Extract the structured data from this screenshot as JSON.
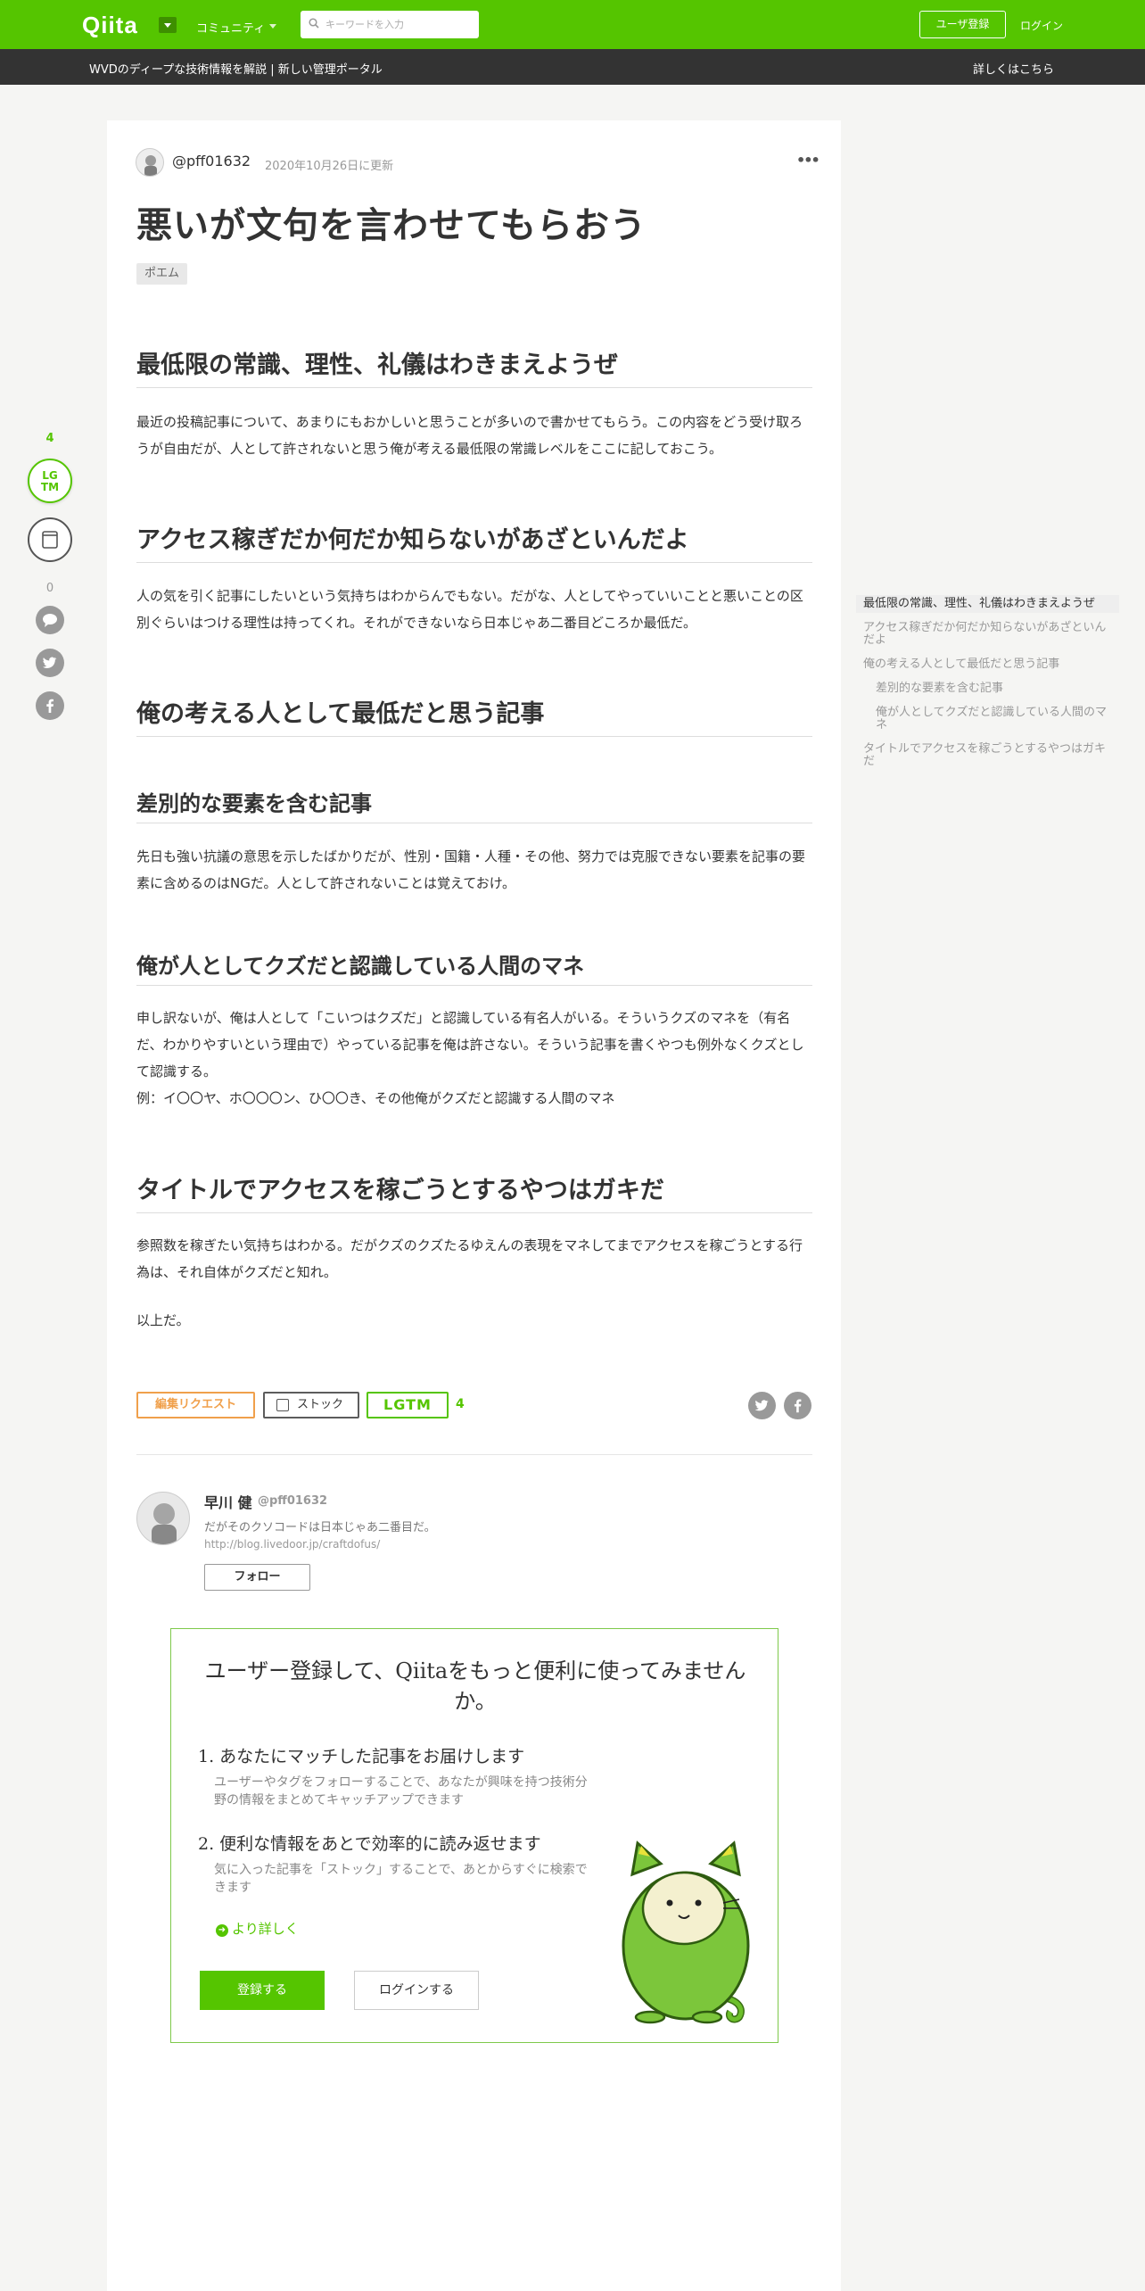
{
  "header": {
    "logo": "Qiita",
    "community": "コミュニティ",
    "search_placeholder": "キーワードを入力",
    "signup": "ユーザ登録",
    "login": "ログイン",
    "accent": "#55c500"
  },
  "banner": {
    "text": "WVDのディープな技術情報を解説 | 新しい管理ポータル",
    "link": "詳しくはこちら"
  },
  "article": {
    "author": "@pff01632",
    "updated": "2020年10月26日に更新",
    "menu": "•••",
    "title": "悪いが文句を言わせてもらおう",
    "tag": "ポエム",
    "sections": [
      {
        "heading": "最低限の常識、理性、礼儀はわきまえようぜ",
        "body": "最近の投稿記事について、あまりにもおかしいと思うことが多いので書かせてもらう。この内容をどう受け取ろうが自由だが、人として許されないと思う俺が考える最低限の常識レベルをここに記しておこう。"
      },
      {
        "heading": "アクセス稼ぎだか何だか知らないがあざといんだよ",
        "body": "人の気を引く記事にしたいという気持ちはわからんでもない。だがな、人としてやっていいことと悪いことの区別ぐらいはつける理性は持ってくれ。それができないなら日本じゃあ二番目どころか最低だ。"
      },
      {
        "heading": "俺の考える人として最低だと思う記事"
      },
      {
        "heading": "差別的な要素を含む記事",
        "body": "先日も強い抗議の意思を示したばかりだが、性別・国籍・人種・その他、努力では克服できない要素を記事の要素に含めるのはNGだ。人として許されないことは覚えておけ。"
      },
      {
        "heading": "俺が人としてクズだと認識している人間のマネ",
        "body": "申し訳ないが、俺は人として「こいつはクズだ」と認識している有名人がいる。そういうクズのマネを（有名だ、わかりやすいという理由で）やっている記事を俺は許さない。そういう記事を書くやつも例外なくクズとして認識する。",
        "example": "例：イ〇〇ヤ、ホ〇〇〇ン、ひ〇〇き、その他俺がクズだと認識する人間のマネ"
      },
      {
        "heading": "タイトルでアクセスを稼ごうとするやつはガキだ",
        "body": "参照数を稼ぎたい気持ちはわかる。だがクズのクズたるゆえんの表現をマネしてまでアクセスを稼ごうとする行為は、それ自体がクズだと知れ。",
        "closing": "以上だ。"
      }
    ]
  },
  "rail": {
    "lgtm_count": "4",
    "lgtm_icon": "LG\nTM",
    "comment_count": "0"
  },
  "toc": [
    "最低限の常識、理性、礼儀はわきまえようぜ",
    "アクセス稼ぎだか何だか知らないがあざといんだよ",
    "俺の考える人として最低だと思う記事",
    "差別的な要素を含む記事",
    "俺が人としてクズだと認識している人間のマネ",
    "タイトルでアクセスを稼ごうとするやつはガキだ"
  ],
  "actions": {
    "edit_request": "編集リクエスト",
    "stock": "ストック",
    "lgtm": "LGTM",
    "lgtm_count": "4"
  },
  "author_box": {
    "name": "早川 健",
    "handle": "@pff01632",
    "bio": "だがそのクソコードは日本じゃあ二番目だ。",
    "url": "http://blog.livedoor.jp/craftdofus/",
    "follow": "フォロー"
  },
  "cta": {
    "title": "ユーザー登録して、Qiitaをもっと便利に使ってみませんか。",
    "point1_title": "1. あなたにマッチした記事をお届けします",
    "point1_desc": "ユーザーやタグをフォローすることで、あなたが興味を持つ技術分野の情報をまとめてキャッチアップできます",
    "point2_title": "2. 便利な情報をあとで効率的に読み返せます",
    "point2_desc": "気に入った記事を「ストック」することで、あとからすぐに検索できます",
    "more": "より詳しく",
    "register": "登録する",
    "login": "ログインする"
  }
}
